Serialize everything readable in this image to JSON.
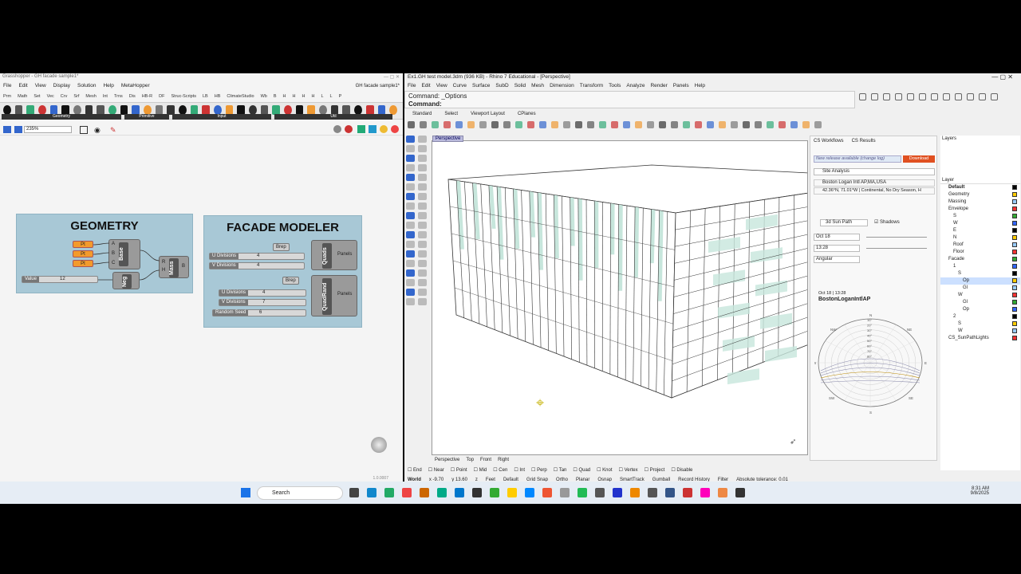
{
  "grasshopper": {
    "title": "Grasshopper - GH facade sample1*",
    "menu": [
      "File",
      "Edit",
      "View",
      "Display",
      "Solution",
      "Help",
      "MetaHopper"
    ],
    "doc_tab": "GH facade sample1*",
    "tabs": [
      "Prm",
      "Math",
      "Set",
      "Vec",
      "Crv",
      "Srf",
      "Mesh",
      "Int",
      "Trns",
      "Dis",
      "HB-R",
      "DF",
      "Struc-Scripts",
      "LB",
      "HB",
      "ClimateStudio",
      "Wb",
      "B",
      "H",
      "H",
      "H",
      "H",
      "L",
      "L",
      "P"
    ],
    "categories": [
      "Geometry",
      "Primitive",
      "Input",
      "Util"
    ],
    "zoom": "235%",
    "version": "1.0.0007",
    "geometry_group": {
      "title": "GEOMETRY",
      "points": [
        "Pt",
        "Pt",
        "Pt"
      ],
      "slider": {
        "label": "Value",
        "value": "12"
      },
      "base": "Base",
      "neg": "Neg",
      "mass": "Mass",
      "ports": [
        "A",
        "B",
        "C",
        "R",
        "H",
        "B"
      ]
    },
    "facade_group": {
      "title": "FACADE MODELER",
      "top": {
        "brep": "Brep",
        "u_label": "U Divisions",
        "u_val": "4",
        "v_label": "V Divisions",
        "v_val": "4",
        "comp": "Quads",
        "out": "Panels"
      },
      "bottom": {
        "brep": "Brep",
        "u_label": "U Divisions",
        "u_val": "4",
        "v_label": "V Divisions",
        "v_val": "7",
        "seed_label": "Random Seed",
        "seed_val": "6",
        "comp": "QuadRand",
        "out": "Panels"
      }
    }
  },
  "rhino": {
    "title": "Ex1.GH test model.3dm (936 KB) - Rhino 7 Educational - [Perspective]",
    "menu": [
      "File",
      "Edit",
      "View",
      "Curve",
      "Surface",
      "SubD",
      "Solid",
      "Mesh",
      "Dimension",
      "Transform",
      "Tools",
      "Analyze",
      "Render",
      "Panels",
      "Help"
    ],
    "cmd1": "Command: _Options",
    "cmd2": "Command:",
    "toolbar_tabs": [
      "Standard",
      "Select",
      "Viewport Layout",
      "CPlanes"
    ],
    "viewport_label": "Perspective",
    "view_tabs": [
      "Perspective",
      "Top",
      "Front",
      "Right"
    ],
    "osnaps": [
      "End",
      "Near",
      "Point",
      "Mid",
      "Cen",
      "Int",
      "Perp",
      "Tan",
      "Quad",
      "Knot",
      "Vertex",
      "Project",
      "Disable"
    ],
    "status": {
      "cplane": "World",
      "x": "x -9.70",
      "y": "y 13.60",
      "z": "z",
      "units": "Feet",
      "layer": "Default",
      "items": [
        "Grid Snap",
        "Ortho",
        "Planar",
        "Osnap",
        "SmartTrack",
        "Gumball",
        "Record History",
        "Filter"
      ],
      "tolerance": "Absolute tolerance: 0.01"
    }
  },
  "climatestudio": {
    "tabs": [
      "CS Workflows",
      "CS Results"
    ],
    "release": "New release available (change log)",
    "download": "Download",
    "analysis": "Site Analysis",
    "location": "Boston Logan Intl AP,MA,USA",
    "coords": "42.36°N, 71.01°W | Continental, No Dry Season, H",
    "mode": "3d Sun Path",
    "shadows": "Shadows",
    "date": "Oct 18",
    "time": "13:28",
    "angle": "Angular",
    "chart_time": "Oct 18 | 13:28",
    "chart_title": "BostonLoganIntlAP",
    "ring_labels": [
      "10°",
      "20°",
      "30°",
      "40°",
      "50°",
      "60°",
      "70°",
      "80°"
    ],
    "compass": [
      "N",
      "E",
      "S",
      "W",
      "NW",
      "NE",
      "SW",
      "SE"
    ]
  },
  "layers": {
    "title": "Layers",
    "header": "Layer",
    "items": [
      {
        "name": "Default",
        "indent": 0
      },
      {
        "name": "Geometry",
        "indent": 0
      },
      {
        "name": "Massing",
        "indent": 0
      },
      {
        "name": "Envelope",
        "indent": 0
      },
      {
        "name": "S",
        "indent": 1
      },
      {
        "name": "W",
        "indent": 1
      },
      {
        "name": "E",
        "indent": 1
      },
      {
        "name": "N",
        "indent": 1
      },
      {
        "name": "Roof",
        "indent": 1
      },
      {
        "name": "Floor",
        "indent": 1
      },
      {
        "name": "Facade",
        "indent": 0
      },
      {
        "name": "1",
        "indent": 1
      },
      {
        "name": "S",
        "indent": 2
      },
      {
        "name": "Op",
        "indent": 3
      },
      {
        "name": "Gl",
        "indent": 3
      },
      {
        "name": "W",
        "indent": 2
      },
      {
        "name": "Gl",
        "indent": 3
      },
      {
        "name": "Op",
        "indent": 3
      },
      {
        "name": "2",
        "indent": 1
      },
      {
        "name": "S",
        "indent": 2
      },
      {
        "name": "W",
        "indent": 2
      },
      {
        "name": "CS_SunPathLights",
        "indent": 0
      }
    ]
  },
  "taskbar": {
    "search": "Search",
    "time": "8:31 AM",
    "date": "9/8/2025"
  },
  "colors": {
    "accent": "#e05020",
    "group": "#a8c8d6",
    "glass": "#c7e6dc",
    "pt": "#f39a2c"
  }
}
